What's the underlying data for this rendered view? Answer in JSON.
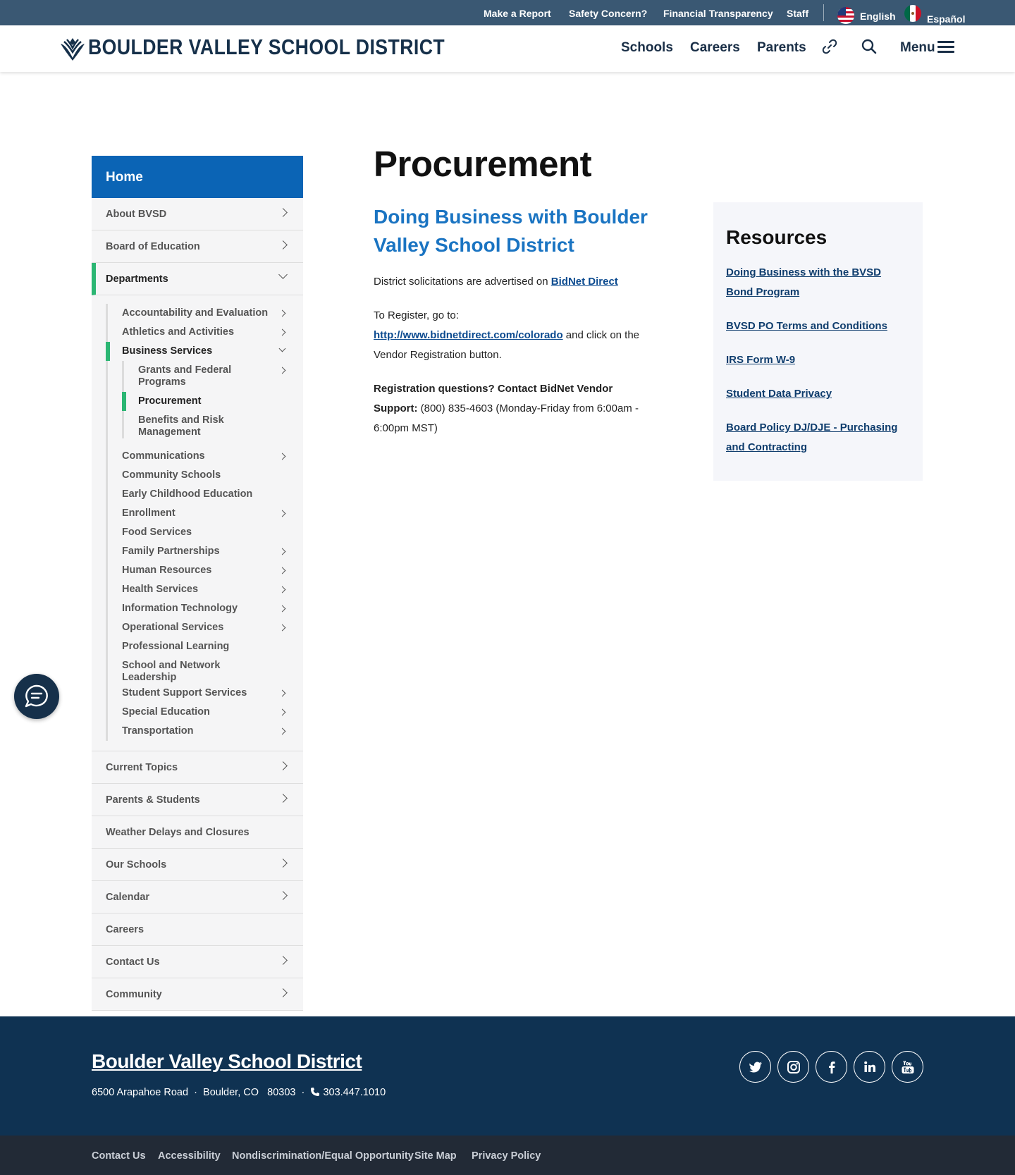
{
  "utility": {
    "links": [
      "Make a Report",
      "Safety Concern?",
      "Financial Transparency",
      "Staff"
    ],
    "languages": [
      "English",
      "Español"
    ]
  },
  "header": {
    "logo_text": "BOULDER VALLEY SCHOOL DISTRICT",
    "nav": [
      "Schools",
      "Careers",
      "Parents"
    ],
    "menu_label": "Menu"
  },
  "sidebar": {
    "home": "Home",
    "top_items": [
      "About BVSD",
      "Board of Education"
    ],
    "departments_label": "Departments",
    "dept_before": [
      "Accountability and Evaluation",
      "Athletics and Activities"
    ],
    "business_services": "Business Services",
    "business_children": [
      "Grants and Federal Programs",
      "Procurement",
      "Benefits and Risk Management"
    ],
    "dept_after": [
      "Communications",
      "Community Schools",
      "Early Childhood Education",
      "Enrollment",
      "Food Services",
      "Family Partnerships",
      "Human Resources",
      "Health Services",
      "Information Technology",
      "Operational Services",
      "Professional Learning",
      "School and Network Leadership",
      "Student Support Services",
      "Special Education",
      "Transportation"
    ],
    "bottom_items": [
      "Current Topics",
      "Parents & Students",
      "Weather Delays and Closures",
      "Our Schools",
      "Calendar",
      "Careers",
      "Contact Us",
      "Community"
    ]
  },
  "main": {
    "title": "Procurement",
    "subheading": "Doing Business with Boulder Valley School District",
    "p1_text": "District solicitations are advertised on ",
    "p1_link": "BidNet Direct",
    "p2_text": "To Register, go to:",
    "p2_link": "http://www.bidnetdirect.com/colorado",
    "p2_after": " and click on the Vendor Registration button.",
    "p3_bold": "Registration questions? Contact BidNet Vendor Support:",
    "p3_text": "  (800) 835-4603 (Monday-Friday from 6:00am - 6:00pm MST)"
  },
  "resources": {
    "title": "Resources",
    "links": [
      "Doing Business with the BVSD Bond Program",
      "BVSD PO Terms and Conditions",
      "IRS Form W-9",
      "Student Data Privacy",
      "Board Policy DJ/DJE - Purchasing and Contracting"
    ]
  },
  "footer": {
    "name": "Boulder Valley School District",
    "street": "6500 Arapahoe Road",
    "city": "Boulder, CO",
    "zip": "80303",
    "phone": "303.447.1010",
    "social": [
      "twitter-icon",
      "instagram-icon",
      "facebook-icon",
      "linkedin-icon",
      "youtube-icon"
    ],
    "bottom_links": [
      "Contact Us",
      "Accessibility",
      "Nondiscrimination/Equal Opportunity",
      "Site Map",
      "Privacy Policy"
    ]
  }
}
